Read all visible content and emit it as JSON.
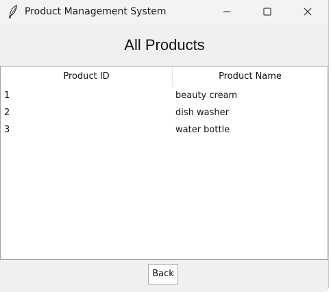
{
  "window": {
    "title": "Product Management System",
    "icon": "feather-icon",
    "controls": [
      "minimize-icon",
      "maximize-icon",
      "close-icon"
    ]
  },
  "page": {
    "heading": "All Products"
  },
  "table": {
    "columns": [
      "Product ID",
      "Product Name"
    ],
    "rows": [
      {
        "id": "1",
        "name": "beauty cream"
      },
      {
        "id": "2",
        "name": "dish washer"
      },
      {
        "id": "3",
        "name": "water bottle"
      }
    ]
  },
  "footer": {
    "back_label": "Back"
  }
}
